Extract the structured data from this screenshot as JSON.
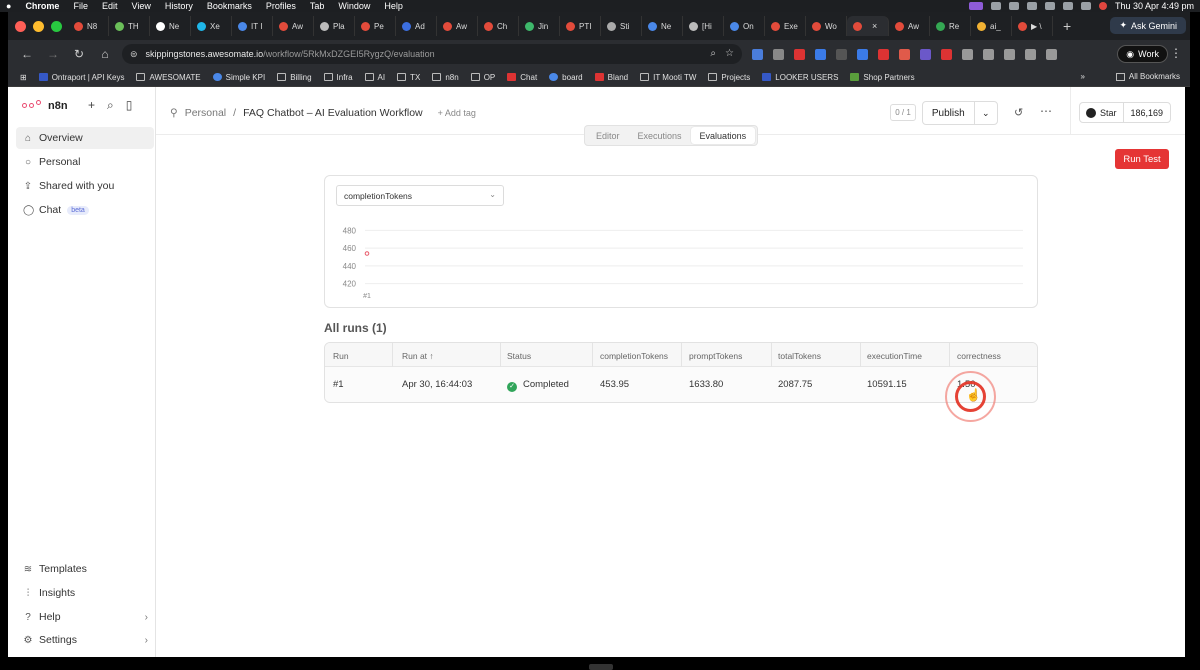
{
  "menubar": {
    "app": "Chrome",
    "items": [
      "File",
      "Edit",
      "View",
      "History",
      "Bookmarks",
      "Profiles",
      "Tab",
      "Window",
      "Help"
    ],
    "clock": "Thu 30 Apr  4:49 pm"
  },
  "tabs": [
    {
      "label": "N8",
      "color": "#e24b3b"
    },
    {
      "label": "TH",
      "color": "#6bbf59"
    },
    {
      "label": "Ne",
      "color": "#ffffff"
    },
    {
      "label": "Xe",
      "color": "#1fb6e8"
    },
    {
      "label": "IT I",
      "color": "#4a88e8"
    },
    {
      "label": "Aw",
      "color": "#e24b3b"
    },
    {
      "label": "Pla",
      "color": "#bbbbbb"
    },
    {
      "label": "Pe",
      "color": "#e24b3b"
    },
    {
      "label": "Ad",
      "color": "#3c6fe0"
    },
    {
      "label": "Aw",
      "color": "#e24b3b"
    },
    {
      "label": "Ch",
      "color": "#e24b3b"
    },
    {
      "label": "Jin",
      "color": "#3eb86b"
    },
    {
      "label": "PTI",
      "color": "#e24b3b"
    },
    {
      "label": "Sti",
      "color": "#aaaaaa"
    },
    {
      "label": "Ne",
      "color": "#4a88e8"
    },
    {
      "label": "[Hi",
      "color": "#bbbbbb"
    },
    {
      "label": "On",
      "color": "#4a88e8"
    },
    {
      "label": "Exe",
      "color": "#e24b3b"
    },
    {
      "label": "Wo",
      "color": "#e24b3b"
    },
    {
      "label": "",
      "color": "#e24b3b",
      "active": true
    },
    {
      "label": "Aw",
      "color": "#e24b3b"
    },
    {
      "label": "Re",
      "color": "#34a853"
    },
    {
      "label": "ai_",
      "color": "#f2b233"
    },
    {
      "label": "▶ \\",
      "color": "#e24b3b"
    }
  ],
  "toolbar": {
    "ask_gemini": "Ask Gemini",
    "url_host": "skippingstones.awesomate.io",
    "url_path": "/workflow/5RkMxDZGEI5RygzQ/evaluation",
    "profile": "Work"
  },
  "bookmarks": [
    {
      "label": "Ontraport | API Keys",
      "style": "b"
    },
    {
      "label": "AWESOMATE",
      "style": "f"
    },
    {
      "label": "Simple KPI",
      "style": "c"
    },
    {
      "label": "Billing",
      "style": "f"
    },
    {
      "label": "Infra",
      "style": "f"
    },
    {
      "label": "AI",
      "style": "f"
    },
    {
      "label": "TX",
      "style": "f"
    },
    {
      "label": "n8n",
      "style": "f"
    },
    {
      "label": "OP",
      "style": "f"
    },
    {
      "label": "Chat",
      "style": "r"
    },
    {
      "label": "board",
      "style": "c"
    },
    {
      "label": "Bland",
      "style": "r"
    },
    {
      "label": "IT Mooti TW",
      "style": "f"
    },
    {
      "label": "Projects",
      "style": "f"
    },
    {
      "label": "LOOKER USERS",
      "style": "b"
    },
    {
      "label": "Shop Partners",
      "style": "g"
    }
  ],
  "all_bookmarks": "All Bookmarks",
  "sidebar": {
    "brand": "n8n",
    "items": [
      {
        "label": "Overview",
        "icon": "house-icon",
        "glyph": "⌂",
        "active": true
      },
      {
        "label": "Personal",
        "icon": "user-icon",
        "glyph": "○"
      },
      {
        "label": "Shared with you",
        "icon": "share-icon",
        "glyph": "⇪"
      },
      {
        "label": "Chat",
        "icon": "chat-icon",
        "glyph": "◯",
        "badge": "beta"
      }
    ],
    "bottom": [
      {
        "label": "Templates",
        "icon": "layers-icon",
        "glyph": "≋"
      },
      {
        "label": "Insights",
        "icon": "chart-icon",
        "glyph": "⫶"
      },
      {
        "label": "Help",
        "icon": "help-icon",
        "glyph": "?",
        "chevron": true
      },
      {
        "label": "Settings",
        "icon": "gear-icon",
        "glyph": "⚙",
        "chevron": true
      }
    ]
  },
  "header": {
    "project": "Personal",
    "workflow_title": "FAQ Chatbot – AI Evaluation Workflow",
    "add_tag": "+ Add tag",
    "counter": "0 / 1",
    "publish": "Publish",
    "github_star": "Star",
    "github_count": "186,169"
  },
  "view_tabs": [
    {
      "label": "Editor"
    },
    {
      "label": "Executions"
    },
    {
      "label": "Evaluations",
      "active": true
    }
  ],
  "run_test": "Run Test",
  "metric_select": "completionTokens",
  "chart_data": {
    "type": "line",
    "categories": [
      "#1"
    ],
    "series": [
      {
        "values": [
          453.95
        ]
      }
    ],
    "y_ticks": [
      "480",
      "460",
      "440",
      "420"
    ],
    "ylim": [
      415,
      485
    ],
    "grid": true,
    "point_color": "#e85a6a"
  },
  "all_runs_title": "All runs (1)",
  "runs_table": {
    "columns": [
      "Run",
      "Run at ↑",
      "Status",
      "completionTokens",
      "promptTokens",
      "totalTokens",
      "executionTime",
      "correctness"
    ],
    "rows": [
      [
        "#1",
        "Apr 30, 16:44:03",
        "Completed",
        "453.95",
        "1633.80",
        "2087.75",
        "10591.15",
        "1.50"
      ]
    ]
  }
}
